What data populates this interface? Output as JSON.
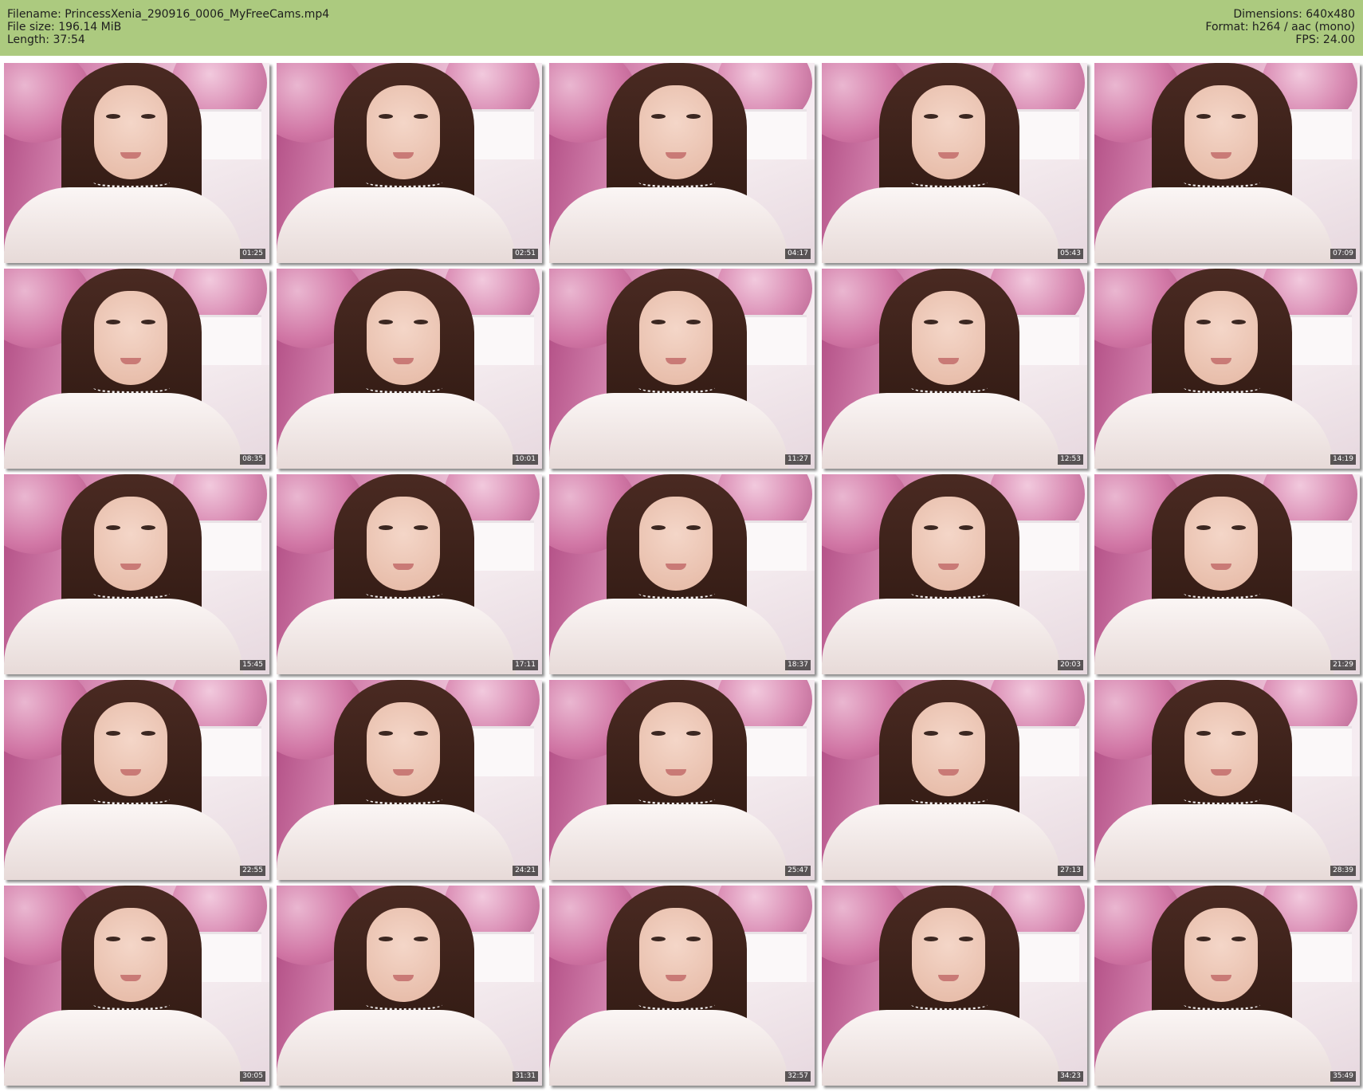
{
  "meta": {
    "filename": "Filename: PrincessXenia_290916_0006_MyFreeCams.mp4",
    "filesize": "File size: 196.14 MiB",
    "length": "Length: 37:54",
    "dimensions": "Dimensions: 640x480",
    "format": "Format: h264 / aac (mono)",
    "fps": "FPS: 24.00"
  },
  "colors": {
    "header_bg": "#acca7f",
    "page_bg": "#ffffff",
    "timestamp_bg": "#000000"
  },
  "thumbnails": [
    "01:25",
    "02:51",
    "04:17",
    "05:43",
    "07:09",
    "08:35",
    "10:01",
    "11:27",
    "12:53",
    "14:19",
    "15:45",
    "17:11",
    "18:37",
    "20:03",
    "21:29",
    "22:55",
    "24:21",
    "25:47",
    "27:13",
    "28:39",
    "30:05",
    "31:31",
    "32:57",
    "34:23",
    "35:49"
  ]
}
